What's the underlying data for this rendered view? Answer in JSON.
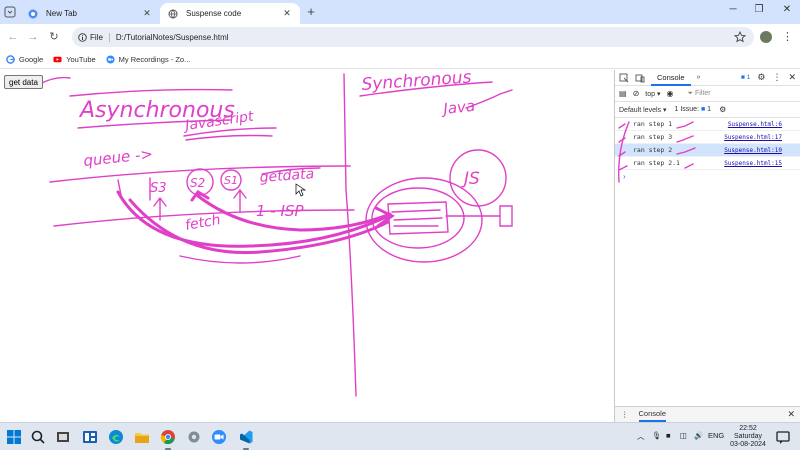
{
  "browser": {
    "tabs": [
      {
        "title": "New Tab",
        "active": false
      },
      {
        "title": "Suspense code",
        "active": true
      }
    ],
    "address": {
      "chip": "File",
      "url": "D:/TutorialNotes/Suspense.html"
    },
    "bookmarks": [
      "Google",
      "YouTube",
      "My Recordings - Zo..."
    ]
  },
  "page": {
    "button_label": "get data",
    "drawing": {
      "left_title": "Asynchronous",
      "left_subtitle": "Javascript",
      "queue_label": "queue ->",
      "queue_items": [
        "S3",
        "S2",
        "S1"
      ],
      "get_data": "getdata",
      "fetch": "fetch",
      "isp": "1 - ISP",
      "right_title": "Synchronous",
      "right_subtitle": "Java",
      "js_label": "JS"
    }
  },
  "devtools": {
    "tab_label": "Console",
    "issues_badge": "1",
    "context": "top",
    "filter_placeholder": "Filter",
    "levels": "Default levels",
    "issues": "1 Issue:",
    "issues_count": "1",
    "logs": [
      {
        "text": "ran step 1",
        "source": "Suspense.html:6",
        "highlight": false
      },
      {
        "text": "ran step 3",
        "source": "Suspense.html:17",
        "highlight": false
      },
      {
        "text": "ran step 2",
        "source": "Suspense.html:10",
        "highlight": true
      },
      {
        "text": "ran step 2.1",
        "source": "Suspense.html:15",
        "highlight": false
      }
    ],
    "drawer_label": "Console"
  },
  "taskbar": {
    "lang": "ENG",
    "time": "22:52",
    "day": "Saturday",
    "date": "03-08-2024"
  },
  "colors": {
    "ink": "#e040c8",
    "tabstrip": "#d3e3fd",
    "accent": "#1a73e8"
  }
}
